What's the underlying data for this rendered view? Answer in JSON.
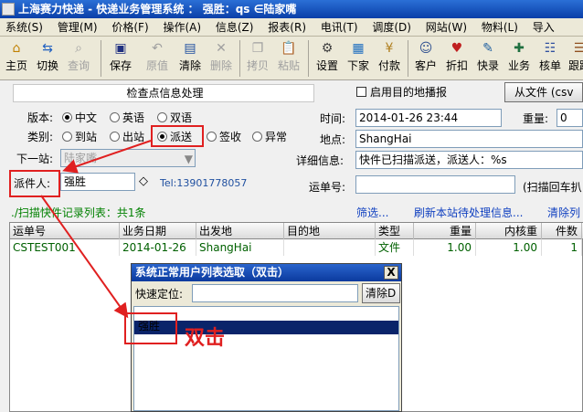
{
  "window": {
    "title": "上海赛力快递 - 快递业务管理系统 ： 强胜：qs  ∈陆家嘴"
  },
  "menu": [
    "系统(S)",
    "管理(M)",
    "价格(F)",
    "操作(A)",
    "信息(Z)",
    "报表(R)",
    "电讯(T)",
    "调度(D)",
    "网站(W)",
    "物料(L)",
    "导入"
  ],
  "toolbar": [
    {
      "label": "主页",
      "icon": "home-icon",
      "disabled": false
    },
    {
      "label": "切换",
      "icon": "switch-icon",
      "disabled": false
    },
    {
      "label": "查询",
      "icon": "search-icon",
      "disabled": true
    },
    {
      "label": "保存",
      "icon": "save-icon",
      "disabled": false
    },
    {
      "label": "原值",
      "icon": "revert-icon",
      "disabled": true
    },
    {
      "label": "清除",
      "icon": "clear-icon",
      "disabled": false
    },
    {
      "label": "删除",
      "icon": "delete-icon",
      "disabled": true
    },
    {
      "label": "拷贝",
      "icon": "copy-icon",
      "disabled": true
    },
    {
      "label": "粘贴",
      "icon": "paste-icon",
      "disabled": true
    },
    {
      "label": "设置",
      "icon": "settings-icon",
      "disabled": false
    },
    {
      "label": "下家",
      "icon": "next-party-icon",
      "disabled": false
    },
    {
      "label": "付款",
      "icon": "payment-icon",
      "disabled": false
    },
    {
      "label": "客户",
      "icon": "customer-icon",
      "disabled": false
    },
    {
      "label": "折扣",
      "icon": "discount-icon",
      "disabled": false
    },
    {
      "label": "快录",
      "icon": "quick-entry-icon",
      "disabled": false
    },
    {
      "label": "业务",
      "icon": "business-icon",
      "disabled": false
    },
    {
      "label": "核单",
      "icon": "verify-icon",
      "disabled": false
    },
    {
      "label": "跟踪",
      "icon": "track-icon",
      "disabled": false
    }
  ],
  "form": {
    "section_title": "检查点信息处理",
    "enable_broadcast_label": "启用目的地播报",
    "from_file_button": "从文件 (csv",
    "version_label": "版本:",
    "version_options": [
      "中文",
      "英语",
      "双语"
    ],
    "version_selected": "中文",
    "category_label": "类别:",
    "category_options": [
      "到站",
      "出站",
      "派送",
      "签收",
      "异常"
    ],
    "category_selected": "派送",
    "next_station_label": "下一站:",
    "next_station_value": "陆家嘴",
    "courier_label": "派件人:",
    "courier_value": "强胜",
    "courier_diamond": "◇",
    "courier_tel": "Tel:13901778057",
    "time_label": "时间:",
    "time_value": "2014-01-26 23:44",
    "weight_label": "重量:",
    "weight_value": "0",
    "location_label": "地点:",
    "location_value": "ShangHai",
    "detail_label": "详细信息:",
    "detail_value": "快件已扫描派送，派送人：%s",
    "waybill_label": "运单号:",
    "waybill_value": "",
    "scan_return_label": "(扫描回车扒"
  },
  "list": {
    "caption": "./扫描快件记录列表：共1条",
    "filter_link": "筛选...",
    "refresh_link": "刷新本站待处理信息...",
    "clear_link": "清除列",
    "columns": [
      "运单号",
      "业务日期",
      "出发地",
      "目的地",
      "类型",
      "重量",
      "内核重",
      "件数"
    ],
    "rows": [
      [
        "CSTEST001",
        "2014-01-26",
        "ShangHai",
        "",
        "文件",
        "1.00",
        "1.00",
        "1"
      ]
    ]
  },
  "dialog": {
    "title": "系统正常用户列表选取（双击）",
    "close": "X",
    "quick_locate_label": "快速定位:",
    "quick_locate_value": "",
    "clear_button": "清除D",
    "items": [
      "强胜"
    ]
  },
  "annotation": {
    "text": "双击",
    "color": "#e02020"
  }
}
